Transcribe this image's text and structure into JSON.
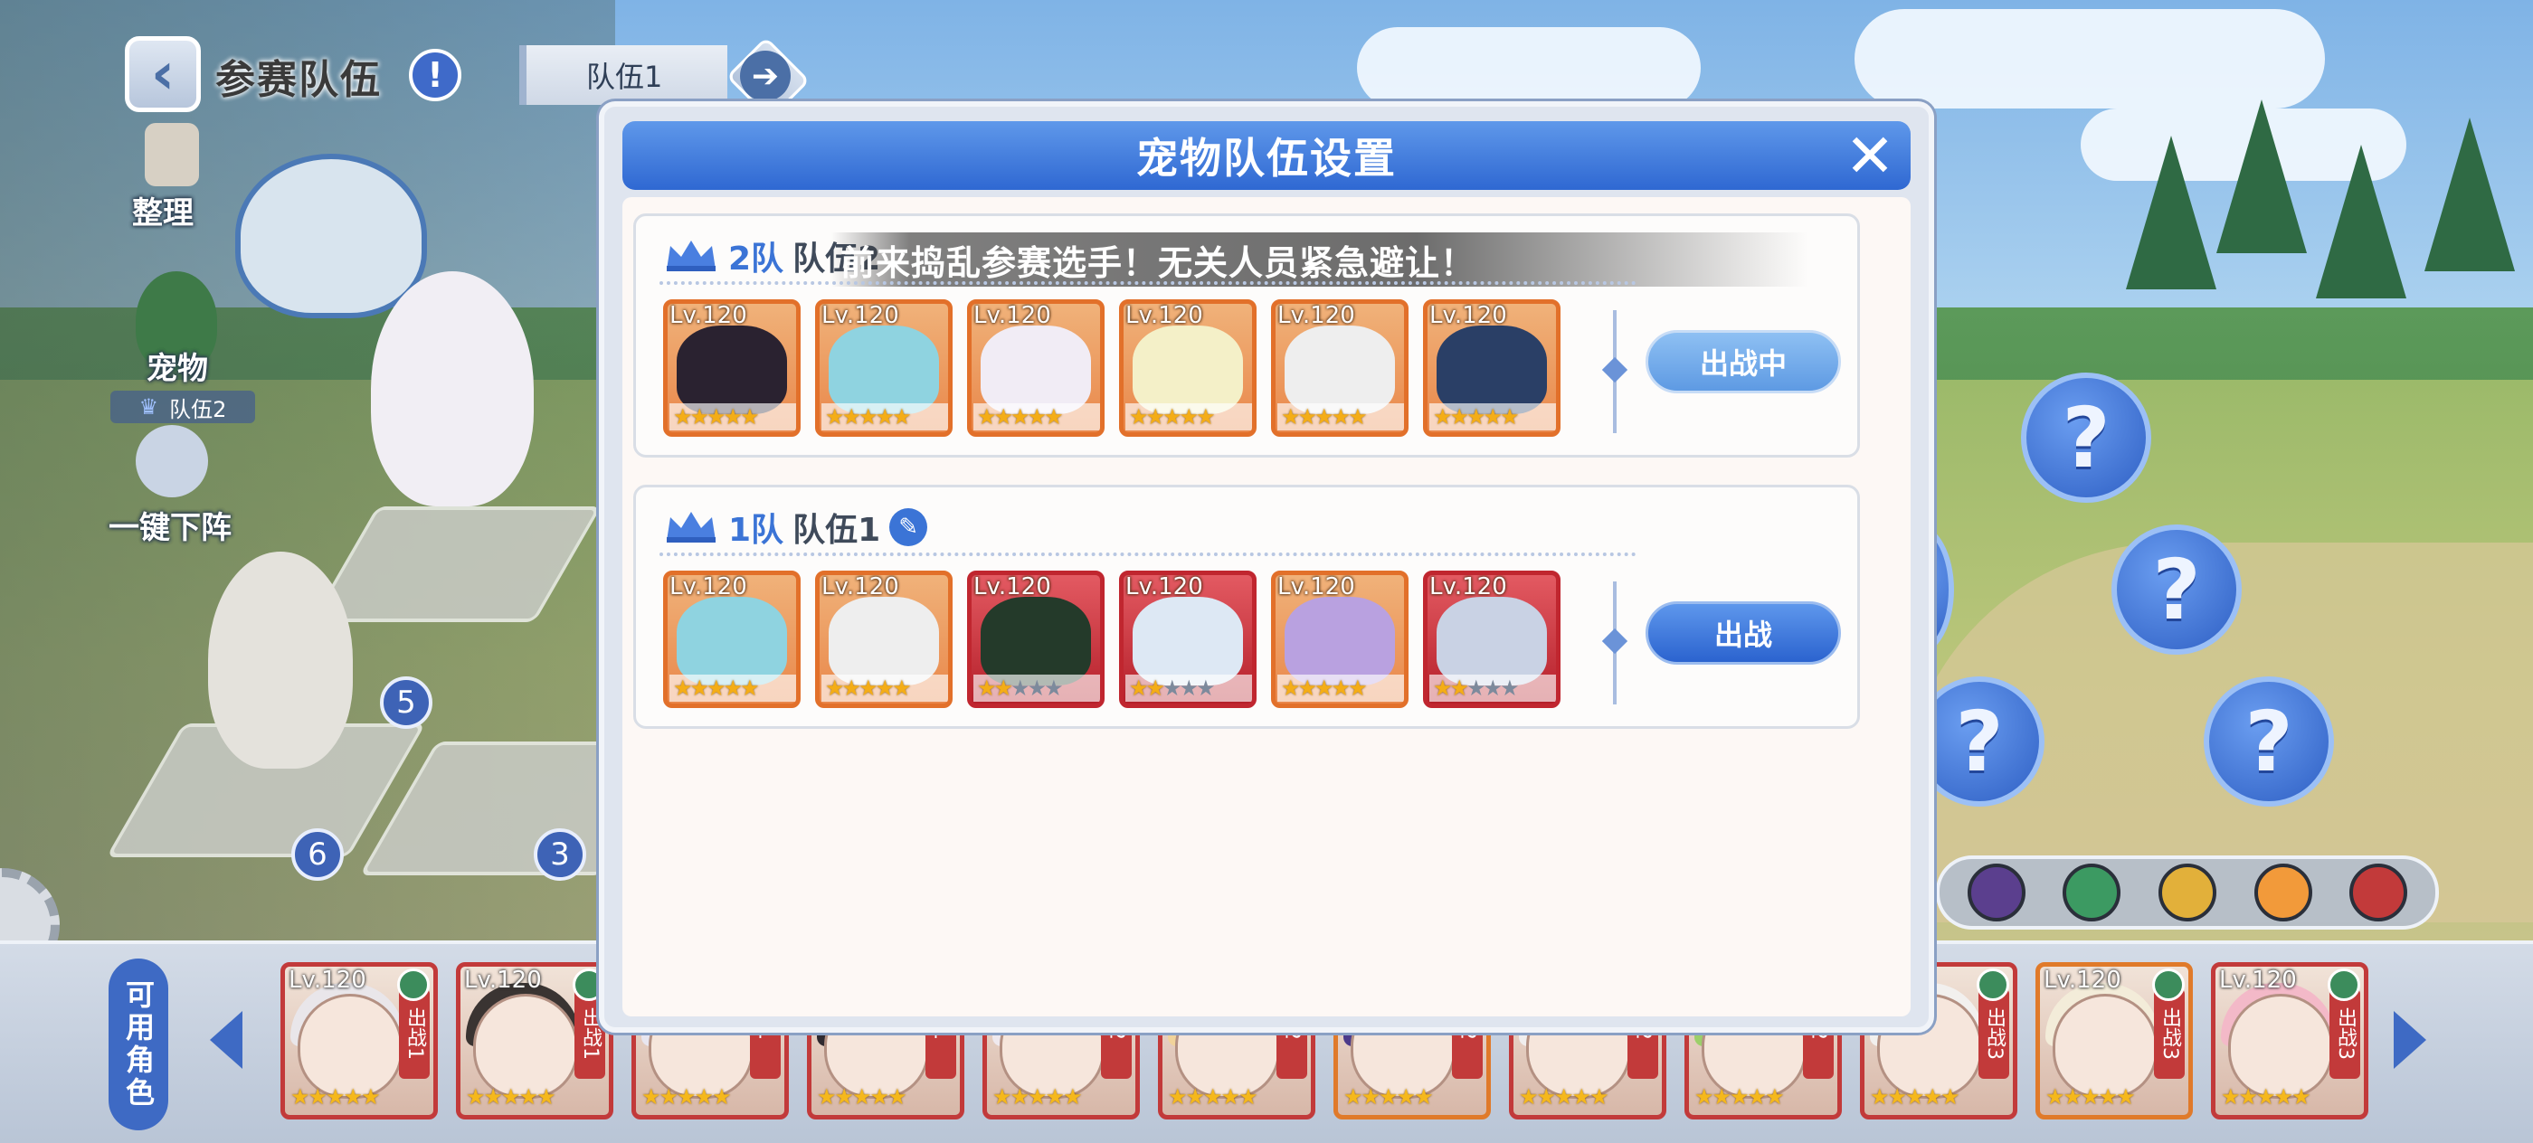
{
  "header": {
    "title": "参赛队伍",
    "selected_team": "队伍1"
  },
  "sidebar": {
    "organize_label": "整理",
    "pet_label": "宠物",
    "pet_team_tag": "队伍2",
    "one_click_label": "一键下阵"
  },
  "formation": {
    "positions": [
      "5",
      "6",
      "3"
    ]
  },
  "bubbles": [
    "?",
    "?",
    "?",
    "?",
    "?"
  ],
  "elements": [
    "dark-star",
    "wind",
    "hex",
    "sun",
    "dragon"
  ],
  "modal": {
    "title": "宠物队伍设置",
    "close": "✕",
    "marquee": "前来捣乱参赛选手！无关人员紧急避让！",
    "teams": [
      {
        "num": "2队",
        "name": "队伍2",
        "button": "出战中",
        "state": "in-battle",
        "pets": [
          {
            "lv": "Lv.120",
            "stars": 5,
            "border": "orange",
            "art": "#2a2230"
          },
          {
            "lv": "Lv.120",
            "stars": 5,
            "border": "orange",
            "art": "#8fd3e0"
          },
          {
            "lv": "Lv.120",
            "stars": 5,
            "border": "orange",
            "art": "#f1ecf5"
          },
          {
            "lv": "Lv.120",
            "stars": 5,
            "border": "orange",
            "art": "#f4f0c8"
          },
          {
            "lv": "Lv.120",
            "stars": 5,
            "border": "orange",
            "art": "#eeeeee"
          },
          {
            "lv": "Lv.120",
            "stars": 5,
            "border": "orange",
            "art": "#2a3f66"
          }
        ]
      },
      {
        "num": "1队",
        "name": "队伍1",
        "button": "出战",
        "state": "go",
        "pets": [
          {
            "lv": "Lv.120",
            "stars": 5,
            "border": "orange",
            "art": "#8fd3e0"
          },
          {
            "lv": "Lv.120",
            "stars": 5,
            "border": "orange",
            "art": "#eeeeee"
          },
          {
            "lv": "Lv.120",
            "stars": 2,
            "border": "red",
            "art": "#243a2a"
          },
          {
            "lv": "Lv.120",
            "stars": 2,
            "border": "red",
            "art": "#dde8f4"
          },
          {
            "lv": "Lv.120",
            "stars": 5,
            "border": "orange",
            "art": "#b9a1e0"
          },
          {
            "lv": "Lv.120",
            "stars": 2,
            "border": "red",
            "art": "#c9d2e4"
          }
        ]
      }
    ]
  },
  "bottom": {
    "available_label": "可用角色",
    "roster": [
      {
        "lv": "Lv.120",
        "tag": "出战1",
        "border": "red",
        "hair": "#e9e6ea"
      },
      {
        "lv": "Lv.120",
        "tag": "出战1",
        "border": "red",
        "hair": "#3a3432"
      },
      {
        "lv": "",
        "tag": "1",
        "border": "red",
        "hair": "#e8e6f0"
      },
      {
        "lv": "",
        "tag": "1",
        "border": "red",
        "hair": "#2f2a30"
      },
      {
        "lv": "",
        "tag": "2",
        "border": "red",
        "hair": "#efe9ee"
      },
      {
        "lv": "",
        "tag": "2",
        "border": "red",
        "hair": "#f1d39a"
      },
      {
        "lv": "",
        "tag": "2",
        "border": "orange",
        "hair": "#4b3a8a"
      },
      {
        "lv": "",
        "tag": "2",
        "border": "red",
        "hair": "#f0eeee"
      },
      {
        "lv": "",
        "tag": "2",
        "border": "red",
        "hair": "#9ccf6a"
      },
      {
        "lv": "",
        "tag": "出战3",
        "border": "red",
        "hair": "#f2f0ee"
      },
      {
        "lv": "Lv.120",
        "tag": "出战3",
        "border": "orange",
        "hair": "#f3ecd9"
      },
      {
        "lv": "Lv.120",
        "tag": "出战3",
        "border": "red",
        "hair": "#f3b9c8"
      }
    ]
  }
}
